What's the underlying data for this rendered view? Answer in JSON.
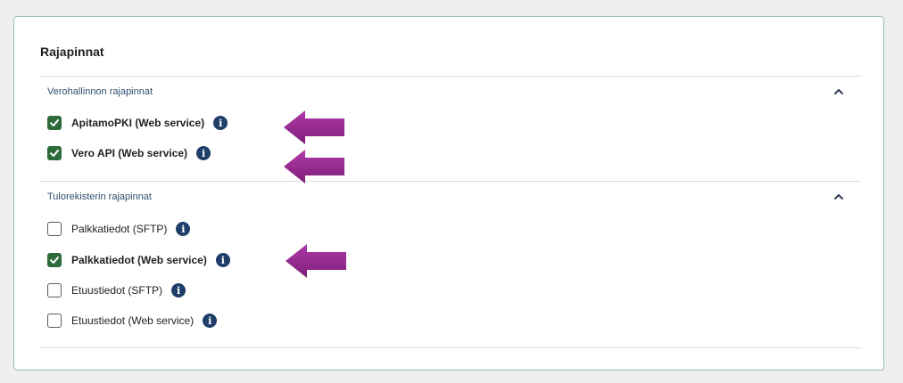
{
  "panel": {
    "title": "Rajapinnat"
  },
  "sections": [
    {
      "title": "Verohallinnon rajapinnat",
      "expanded": true,
      "chevron_icon": "chevron-up-icon",
      "items": [
        {
          "label": "ApitamoPKI (Web service)",
          "checked": true
        },
        {
          "label": "Vero API (Web service)",
          "checked": true
        }
      ]
    },
    {
      "title": "Tulorekisterin rajapinnat",
      "expanded": true,
      "chevron_icon": "chevron-up-icon",
      "items": [
        {
          "label": "Palkkatiedot (SFTP)",
          "checked": false
        },
        {
          "label": "Palkkatiedot (Web service)",
          "checked": true
        },
        {
          "label": "Etuustiedot (SFTP)",
          "checked": false
        },
        {
          "label": "Etuustiedot (Web service)",
          "checked": false
        }
      ]
    }
  ],
  "info_icon": {
    "glyph": "i",
    "name": "info-icon"
  },
  "colors": {
    "accent_green": "#2e6b3a",
    "info_blue": "#1f3f6a",
    "arrow_purple": "#9b2a96",
    "border": "#9cbfa5"
  }
}
